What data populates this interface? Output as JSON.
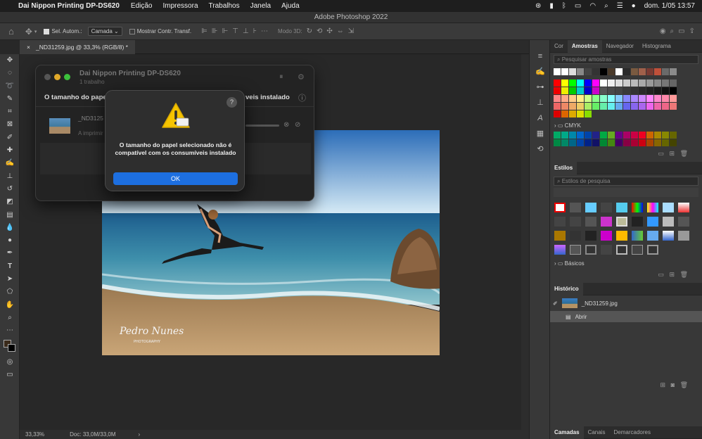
{
  "menubar": {
    "app": "Dai Nippon Printing DP-DS620",
    "items": [
      "Edição",
      "Impressora",
      "Trabalhos",
      "Janela",
      "Ajuda"
    ],
    "datetime": "dom. 1/05  13:57"
  },
  "window": {
    "title": "Adobe Photoshop 2022"
  },
  "options": {
    "auto_select": "Sel. Autom.:",
    "layer_select": "Camada",
    "show_transform": "Mostrar Contr. Transf.",
    "mode3d": "Modo 3D:"
  },
  "document": {
    "tab": "_ND31259.jpg @ 33,3% (RGB/8) *"
  },
  "status": {
    "zoom": "33,33%",
    "doc": "Doc: 33,0M/33,0M"
  },
  "print_window": {
    "title": "Dai Nippon Printing DP-DS620",
    "subtitle": "1 trabalho",
    "message_left": "O tamanho do papel",
    "message_right": "veis instalado",
    "job_name": "_ND3125",
    "job_status": "A imprimir"
  },
  "alert": {
    "message": "O tamanho do papel selecionado não é compatível com os consumíveis instalado",
    "ok": "OK",
    "help": "?"
  },
  "swatches_panel": {
    "tabs": [
      "Cor",
      "Amostras",
      "Navegador",
      "Histograma"
    ],
    "search": "Pesquisar amostras",
    "group": "CMYK"
  },
  "styles_panel": {
    "tab": "Estilos",
    "search": "Estilos de pesquisa",
    "group": "Básicos"
  },
  "history_panel": {
    "tab": "Histórico",
    "snapshot": "_ND31259.jpg",
    "step": "Abrir"
  },
  "layers_panel": {
    "tabs": [
      "Camadas",
      "Canais",
      "Demarcadores"
    ]
  },
  "photo": {
    "signature": "Pedro Nunes",
    "signature_sub": "PHOTOGRAPHY"
  },
  "colors": {
    "accent": "#1d6fe0",
    "warning": "#f5c400"
  }
}
